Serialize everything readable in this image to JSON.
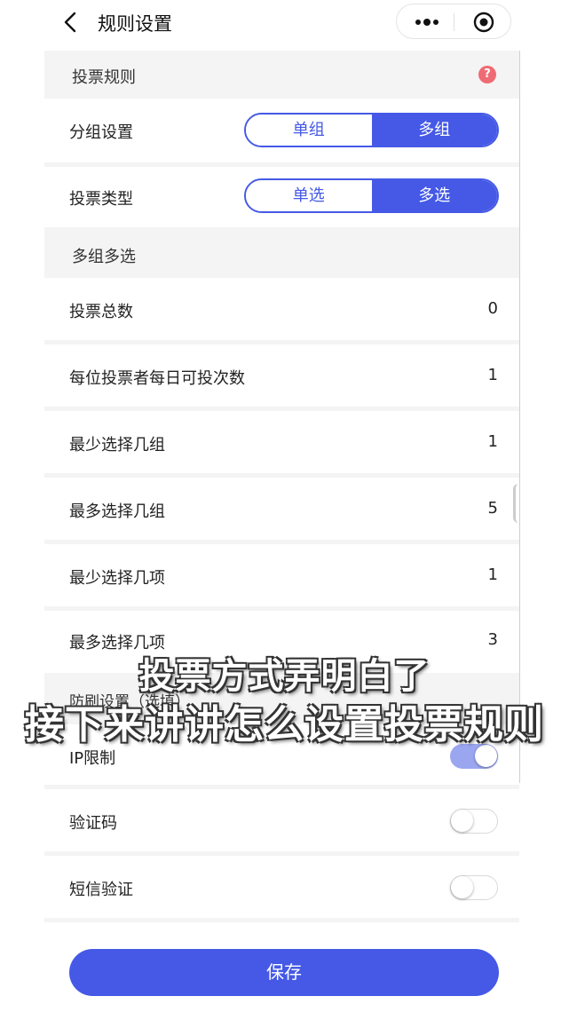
{
  "nav": {
    "title": "规则设置"
  },
  "rules_header": "投票规则",
  "group_setting": {
    "label": "分组设置",
    "options": [
      "单组",
      "多组"
    ],
    "selected": "多组"
  },
  "vote_type": {
    "label": "投票类型",
    "options": [
      "单选",
      "多选"
    ],
    "selected": "多选"
  },
  "section_multi": "多组多选",
  "rows": [
    {
      "label": "投票总数",
      "value": "0"
    },
    {
      "label": "每位投票者每日可投次数",
      "value": "1"
    },
    {
      "label": "最少选择几组",
      "value": "1"
    },
    {
      "label": "最多选择几组",
      "value": "5"
    },
    {
      "label": "最少选择几项",
      "value": "1"
    },
    {
      "label": "最多选择几项",
      "value": "3"
    }
  ],
  "anti_brush_header": "防刷设置（选填）",
  "toggles": [
    {
      "label": "IP限制",
      "on": true
    },
    {
      "label": "验证码",
      "on": false
    },
    {
      "label": "短信验证",
      "on": false
    }
  ],
  "caption": {
    "line1": "投票方式弄明白了",
    "line2": "接下来讲讲怎么设置投票规则"
  },
  "save_label": "保存",
  "colors": {
    "accent": "#4559e6",
    "help": "#ee6b74",
    "section_bg": "#f4f4f4"
  }
}
